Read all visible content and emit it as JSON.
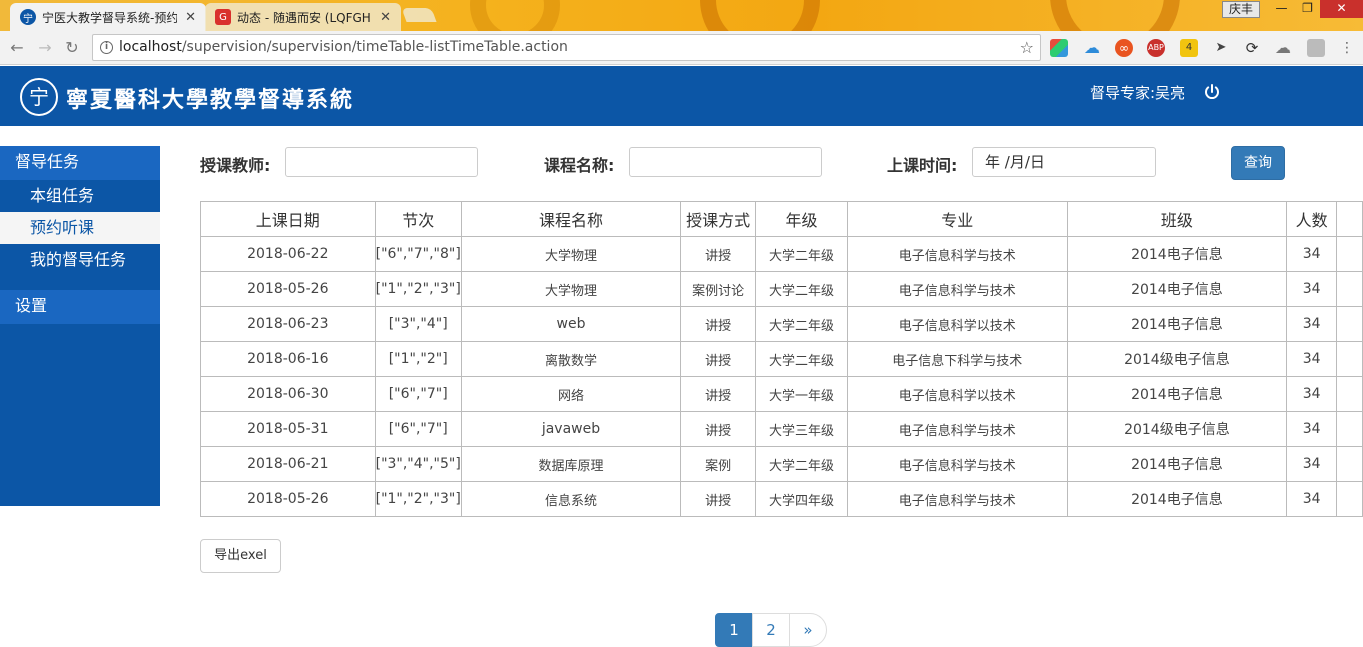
{
  "browser": {
    "tabs": [
      {
        "title": "宁医大教学督导系统-预约",
        "active": true
      },
      {
        "title": "动态 - 随遇而安 (LQFGH",
        "active": false
      }
    ],
    "window_user": "庆丰",
    "url_host": "localhost",
    "url_path": "/supervision/supervision/timeTable-listTimeTable.action"
  },
  "header": {
    "logo_mark": "宁",
    "logo_text": "寧夏醫科大學教學督導系統",
    "user_label": "督导专家:吴亮"
  },
  "sidebar": {
    "groups": [
      {
        "label": "督导任务",
        "items": [
          {
            "label": "本组任务",
            "active": false
          },
          {
            "label": "预约听课",
            "active": true
          },
          {
            "label": "我的督导任务",
            "active": false
          }
        ]
      },
      {
        "label": "设置",
        "items": []
      }
    ]
  },
  "search": {
    "teacher_label": "授课教师:",
    "teacher_value": "",
    "course_label": "课程名称:",
    "course_value": "",
    "time_label": "上课时间:",
    "time_value": "年 /月/日",
    "query_button": "查询"
  },
  "table": {
    "headers": [
      "上课日期",
      "节次",
      "课程名称",
      "授课方式",
      "年级",
      "专业",
      "班级",
      "人数"
    ],
    "rows": [
      [
        "2018-06-22",
        "[\"6\",\"7\",\"8\"]",
        "大学物理",
        "讲授",
        "大学二年级",
        "电子信息科学与技术",
        "2014电子信息",
        "34"
      ],
      [
        "2018-05-26",
        "[\"1\",\"2\",\"3\"]",
        "大学物理",
        "案例讨论",
        "大学二年级",
        "电子信息科学与技术",
        "2014电子信息",
        "34"
      ],
      [
        "2018-06-23",
        "[\"3\",\"4\"]",
        "web",
        "讲授",
        "大学二年级",
        "电子信息科学以技术",
        "2014电子信息",
        "34"
      ],
      [
        "2018-06-16",
        "[\"1\",\"2\"]",
        "离散数学",
        "讲授",
        "大学二年级",
        "电子信息下科学与技术",
        "2014级电子信息",
        "34"
      ],
      [
        "2018-06-30",
        "[\"6\",\"7\"]",
        "网络",
        "讲授",
        "大学一年级",
        "电子信息科学以技术",
        "2014电子信息",
        "34"
      ],
      [
        "2018-05-31",
        "[\"6\",\"7\"]",
        "javaweb",
        "讲授",
        "大学三年级",
        "电子信息科学与技术",
        "2014级电子信息",
        "34"
      ],
      [
        "2018-06-21",
        "[\"3\",\"4\",\"5\"]",
        "数据库原理",
        "案例",
        "大学二年级",
        "电子信息科学与技术",
        "2014电子信息",
        "34"
      ],
      [
        "2018-05-26",
        "[\"1\",\"2\",\"3\"]",
        "信息系统",
        "讲授",
        "大学四年级",
        "电子信息科学与技术",
        "2014电子信息",
        "34"
      ]
    ]
  },
  "export_button": "导出exel",
  "pagination": {
    "pages": [
      "1",
      "2"
    ],
    "current": "1",
    "next": "»"
  },
  "colors": {
    "brand": "#0c56a6",
    "primary": "#337ab7"
  }
}
